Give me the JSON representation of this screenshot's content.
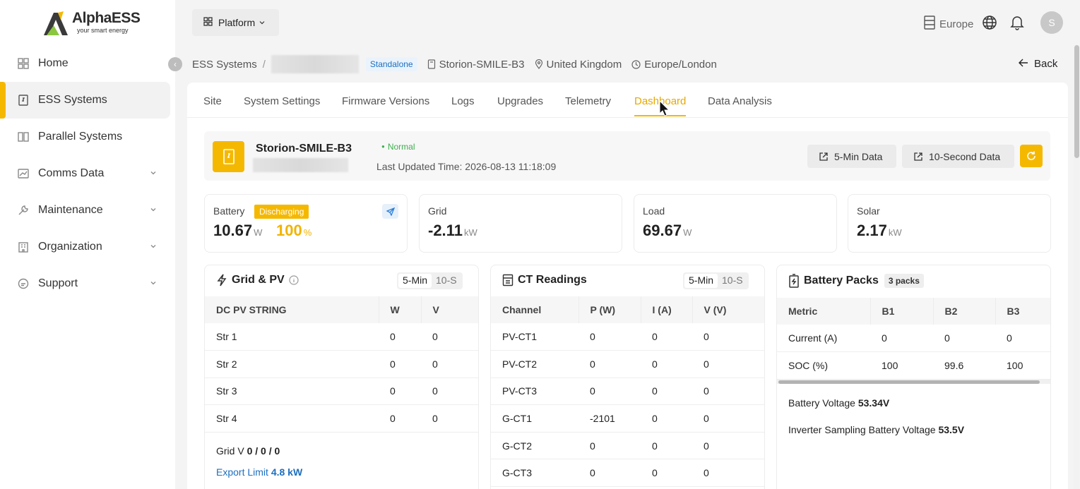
{
  "brand": {
    "name": "AlphaESS",
    "tagline": "your smart energy"
  },
  "sidebar": {
    "items": [
      {
        "label": "Home",
        "icon": "home-grid-icon",
        "active": false
      },
      {
        "label": "ESS Systems",
        "icon": "ess-icon",
        "active": true
      },
      {
        "label": "Parallel Systems",
        "icon": "parallel-icon",
        "active": false
      },
      {
        "label": "Comms Data",
        "icon": "chart-icon",
        "active": false,
        "expandable": true
      },
      {
        "label": "Maintenance",
        "icon": "wrench-icon",
        "active": false,
        "expandable": true
      },
      {
        "label": "Organization",
        "icon": "building-icon",
        "active": false,
        "expandable": true
      },
      {
        "label": "Support",
        "icon": "support-icon",
        "active": false,
        "expandable": true
      }
    ]
  },
  "header": {
    "platform_label": "Platform",
    "region": "Europe",
    "avatar_initial": "S"
  },
  "breadcrumb": {
    "root": "ESS Systems",
    "separator": "/",
    "tag": "Standalone",
    "model": "Storion-SMILE-B3",
    "country": "United Kingdom",
    "timezone": "Europe/London",
    "back_label": "Back"
  },
  "tabs": [
    "Site",
    "System Settings",
    "Firmware Versions",
    "Logs",
    "Upgrades",
    "Telemetry",
    "Dashboard",
    "Data Analysis"
  ],
  "active_tab": "Dashboard",
  "device": {
    "name": "Storion-SMILE-B3",
    "status": "Normal",
    "last_updated": "Last Updated Time: 2026-08-13 11:18:09",
    "btn_5min": "5-Min Data",
    "btn_10s": "10-Second Data"
  },
  "stats": {
    "battery": {
      "label": "Battery",
      "state": "Discharging",
      "value": "10.67",
      "unit": "W",
      "soc": "100",
      "soc_unit": "%"
    },
    "grid": {
      "label": "Grid",
      "value": "-2.11",
      "unit": "kW"
    },
    "load": {
      "label": "Load",
      "value": "69.67",
      "unit": "W"
    },
    "solar": {
      "label": "Solar",
      "value": "2.17",
      "unit": "kW"
    }
  },
  "grid_pv": {
    "title": "Grid & PV",
    "toggle": [
      "5-Min",
      "10-S"
    ],
    "columns": [
      "DC PV STRING",
      "W",
      "V"
    ],
    "rows": [
      [
        "Str 1",
        "0",
        "0"
      ],
      [
        "Str 2",
        "0",
        "0"
      ],
      [
        "Str 3",
        "0",
        "0"
      ],
      [
        "Str 4",
        "0",
        "0"
      ]
    ],
    "grid_v_label": "Grid V",
    "grid_v_value": "0 / 0 / 0",
    "export_label": "Export Limit",
    "export_value": "4.8 kW"
  },
  "ct": {
    "title": "CT Readings",
    "toggle": [
      "5-Min",
      "10-S"
    ],
    "columns": [
      "Channel",
      "P (W)",
      "I (A)",
      "V (V)"
    ],
    "rows": [
      [
        "PV-CT1",
        "0",
        "0",
        "0"
      ],
      [
        "PV-CT2",
        "0",
        "0",
        "0"
      ],
      [
        "PV-CT3",
        "0",
        "0",
        "0"
      ],
      [
        "G-CT1",
        "-2101",
        "0",
        "0"
      ],
      [
        "G-CT2",
        "0",
        "0",
        "0"
      ],
      [
        "G-CT3",
        "0",
        "0",
        "0"
      ]
    ]
  },
  "packs": {
    "title": "Battery Packs",
    "badge": "3 packs",
    "columns": [
      "Metric",
      "B1",
      "B2",
      "B3"
    ],
    "rows": [
      [
        "Current (A)",
        "0",
        "0",
        "0"
      ],
      [
        "SOC (%)",
        "100",
        "99.6",
        "100"
      ]
    ],
    "voltage_label": "Battery Voltage",
    "voltage_value": "53.34V",
    "inv_label": "Inverter Sampling Battery Voltage",
    "inv_value": "53.5V"
  },
  "colors": {
    "accent": "#f5b800",
    "link": "#1d6fbf",
    "ok": "#3fae4e"
  }
}
